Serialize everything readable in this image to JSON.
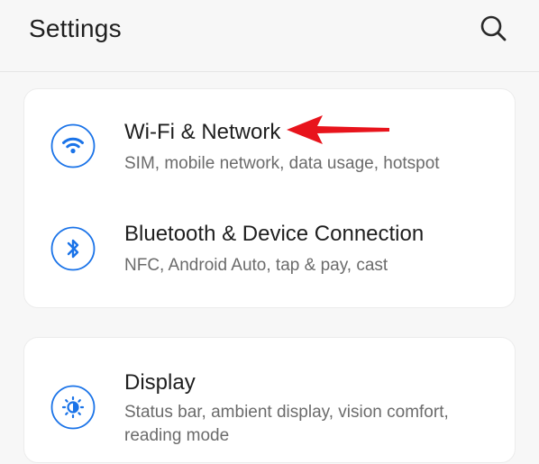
{
  "header": {
    "title": "Settings",
    "search_icon": "search-icon"
  },
  "sections": [
    {
      "items": [
        {
          "icon": "wifi-icon",
          "title": "Wi-Fi & Network",
          "subtitle": "SIM, mobile network, data usage, hotspot"
        },
        {
          "icon": "bluetooth-icon",
          "title": "Bluetooth & Device Connection",
          "subtitle": "NFC, Android Auto, tap & pay, cast"
        }
      ]
    },
    {
      "items": [
        {
          "icon": "brightness-icon",
          "title": "Display",
          "subtitle": "Status bar, ambient display, vision comfort, reading mode"
        }
      ]
    }
  ],
  "colors": {
    "accent": "#1a73e8",
    "annotation": "#e8141c",
    "background": "#f7f7f7",
    "card": "#ffffff"
  }
}
